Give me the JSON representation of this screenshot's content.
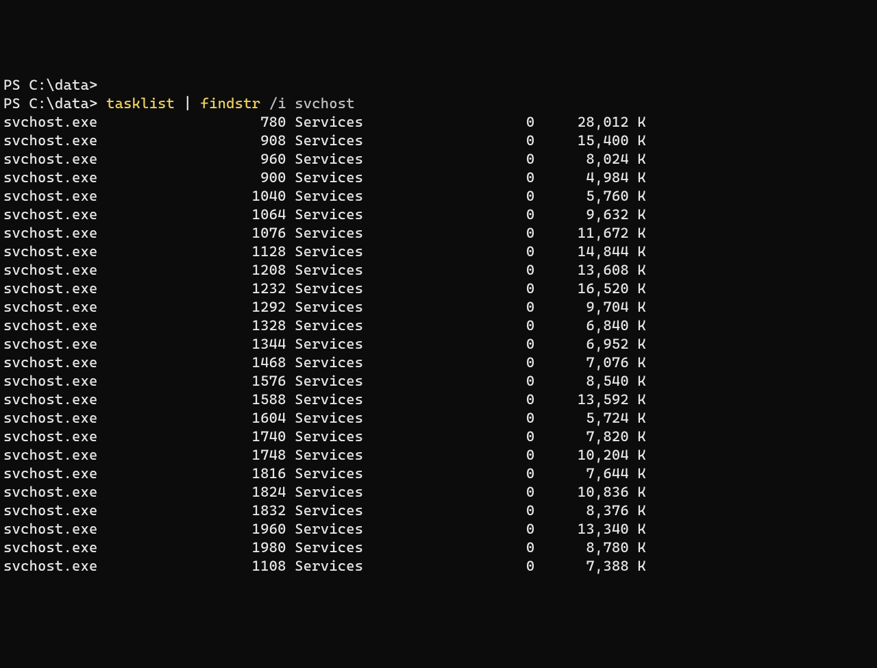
{
  "prompt": "PS C:\\data>",
  "command": {
    "cmd1": "tasklist",
    "pipe": "|",
    "cmd2": "findstr",
    "flag": "/i",
    "arg": "svchost"
  },
  "processes": [
    {
      "name": "svchost.exe",
      "pid": "780",
      "session": "Services",
      "snum": "0",
      "mem": "28,012 K"
    },
    {
      "name": "svchost.exe",
      "pid": "908",
      "session": "Services",
      "snum": "0",
      "mem": "15,400 K"
    },
    {
      "name": "svchost.exe",
      "pid": "960",
      "session": "Services",
      "snum": "0",
      "mem": "8,024 K"
    },
    {
      "name": "svchost.exe",
      "pid": "900",
      "session": "Services",
      "snum": "0",
      "mem": "4,984 K"
    },
    {
      "name": "svchost.exe",
      "pid": "1040",
      "session": "Services",
      "snum": "0",
      "mem": "5,760 K"
    },
    {
      "name": "svchost.exe",
      "pid": "1064",
      "session": "Services",
      "snum": "0",
      "mem": "9,632 K"
    },
    {
      "name": "svchost.exe",
      "pid": "1076",
      "session": "Services",
      "snum": "0",
      "mem": "11,672 K"
    },
    {
      "name": "svchost.exe",
      "pid": "1128",
      "session": "Services",
      "snum": "0",
      "mem": "14,844 K"
    },
    {
      "name": "svchost.exe",
      "pid": "1208",
      "session": "Services",
      "snum": "0",
      "mem": "13,608 K"
    },
    {
      "name": "svchost.exe",
      "pid": "1232",
      "session": "Services",
      "snum": "0",
      "mem": "16,520 K"
    },
    {
      "name": "svchost.exe",
      "pid": "1292",
      "session": "Services",
      "snum": "0",
      "mem": "9,704 K"
    },
    {
      "name": "svchost.exe",
      "pid": "1328",
      "session": "Services",
      "snum": "0",
      "mem": "6,840 K"
    },
    {
      "name": "svchost.exe",
      "pid": "1344",
      "session": "Services",
      "snum": "0",
      "mem": "6,952 K"
    },
    {
      "name": "svchost.exe",
      "pid": "1468",
      "session": "Services",
      "snum": "0",
      "mem": "7,076 K"
    },
    {
      "name": "svchost.exe",
      "pid": "1576",
      "session": "Services",
      "snum": "0",
      "mem": "8,540 K"
    },
    {
      "name": "svchost.exe",
      "pid": "1588",
      "session": "Services",
      "snum": "0",
      "mem": "13,592 K"
    },
    {
      "name": "svchost.exe",
      "pid": "1604",
      "session": "Services",
      "snum": "0",
      "mem": "5,724 K"
    },
    {
      "name": "svchost.exe",
      "pid": "1740",
      "session": "Services",
      "snum": "0",
      "mem": "7,820 K"
    },
    {
      "name": "svchost.exe",
      "pid": "1748",
      "session": "Services",
      "snum": "0",
      "mem": "10,204 K"
    },
    {
      "name": "svchost.exe",
      "pid": "1816",
      "session": "Services",
      "snum": "0",
      "mem": "7,644 K"
    },
    {
      "name": "svchost.exe",
      "pid": "1824",
      "session": "Services",
      "snum": "0",
      "mem": "10,836 K"
    },
    {
      "name": "svchost.exe",
      "pid": "1832",
      "session": "Services",
      "snum": "0",
      "mem": "8,376 K"
    },
    {
      "name": "svchost.exe",
      "pid": "1960",
      "session": "Services",
      "snum": "0",
      "mem": "13,340 K"
    },
    {
      "name": "svchost.exe",
      "pid": "1980",
      "session": "Services",
      "snum": "0",
      "mem": "8,780 K"
    },
    {
      "name": "svchost.exe",
      "pid": "1108",
      "session": "Services",
      "snum": "0",
      "mem": "7,388 K"
    }
  ],
  "cols": {
    "name_w": 25,
    "pid_w": 8,
    "sess_w": 17,
    "snum_w": 11,
    "mem_w": 13
  }
}
